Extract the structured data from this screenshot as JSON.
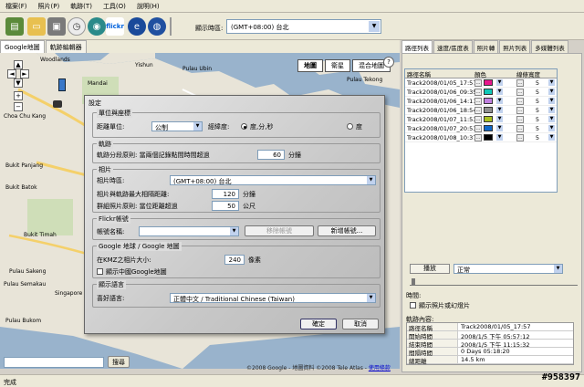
{
  "menu": [
    "檔案(F)",
    "照片(P)",
    "軌跡(T)",
    "工具(O)",
    "說明(H)"
  ],
  "toolbar": {
    "timezone_label": "顯示時區:",
    "timezone_value": "(GMT+08:00) 台北",
    "flickr_label": "flickr",
    "icons": [
      "open-icon",
      "folder-icon",
      "save-icon",
      "clock-icon",
      "globe-icon",
      "flickr-icon",
      "ie-icon",
      "google-earth-icon"
    ]
  },
  "map_tabs": [
    "Google地圖",
    "軌跡編輯器"
  ],
  "map": {
    "types": [
      "地圖",
      "衛星",
      "混合地圖"
    ],
    "copyright": "©2008 Google - 地圖資料 ©2008 Tele Atlas - ",
    "terms_link": "使用條款",
    "search_button": "搜尋",
    "places": [
      "Woodlands",
      "Mandai",
      "Yishun",
      "Pulau Ubin",
      "Choa Chu Kang",
      "Bukit Panjang",
      "Bukit Batok",
      "Bukit Timah",
      "Pulau Tekong",
      "Singapore",
      "Pulau Sakeng",
      "Pulau Semakau",
      "Pulau Bukom"
    ]
  },
  "dialog": {
    "title": "設定",
    "group_unit": "單位與座標",
    "distance_unit_label": "距離單位:",
    "distance_unit_value": "公制",
    "coord_label": "經緯度:",
    "coord_opt1": "度,分,秒",
    "coord_opt2": "度",
    "group_track": "軌跡",
    "track_split_label": "軌跡分段原則: 當兩個記錄點間時間超過",
    "track_split_value": "60",
    "track_split_unit": "分鐘",
    "group_photo": "相片",
    "photo_tz_label": "相片時區:",
    "photo_tz_value": "(GMT+08:00) 台北",
    "photo_time_label": "相片與軌跡最大相隔距離:",
    "photo_time_value": "120",
    "photo_time_unit": "分鐘",
    "photo_group_label": "群組照片原則: 當位距離超過",
    "photo_group_value": "50",
    "photo_group_unit": "公尺",
    "group_flickr": "Flickr帳號",
    "flickr_account_label": "帳號名稱:",
    "flickr_remove": "移除帳號",
    "flickr_add": "新增帳號...",
    "group_google": "Google 地球 / Google 地圖",
    "kmz_label": "在KMZ之相片大小:",
    "kmz_value": "240",
    "kmz_unit": "像素",
    "china_map_label": "顯示中國Google地圖",
    "group_lang": "顯示語言",
    "lang_label": "喜好語言:",
    "lang_value": "正體中文 / Traditional Chinese (Taiwan)",
    "ok": "確定",
    "cancel": "取消"
  },
  "right_tabs": [
    "路徑列表",
    "速度/區度表",
    "照片轉",
    "照片列表",
    "多媒體列表"
  ],
  "tracks": {
    "headers": [
      "路徑名稱",
      "顏色",
      "線條寬度"
    ],
    "rows": [
      {
        "name": "Track2008/01/05_17:57",
        "color": "#e8168c",
        "width": "5"
      },
      {
        "name": "Track2008/01/06_09:35",
        "color": "#10c8b8",
        "width": "5"
      },
      {
        "name": "Track2008/01/06_14:11",
        "color": "#c080e0",
        "width": "5"
      },
      {
        "name": "Track2008/01/06_18:54",
        "color": "#909090",
        "width": "5"
      },
      {
        "name": "Track2008/01/07_11:53",
        "color": "#a8c020",
        "width": "5"
      },
      {
        "name": "Track2008/01/07_20:53",
        "color": "#1068c8",
        "width": "5"
      },
      {
        "name": "Track2008/01/08_10:37",
        "color": "#000000",
        "width": "5"
      }
    ]
  },
  "playback": {
    "play": "播放",
    "speed": "正常",
    "time_label": "時間:",
    "show_photo_label": "顯示照片或幻燈片",
    "info_label": "軌跡內容:"
  },
  "info": [
    {
      "k": "路徑名稱",
      "v": "Track2008/01/05_17:57"
    },
    {
      "k": "開始時間",
      "v": "2008/1/5 下午 05:57:12"
    },
    {
      "k": "結束時間",
      "v": "2008/1/5 下午 11:15:32"
    },
    {
      "k": "間隔時間",
      "v": "0 Days 05:18:20"
    },
    {
      "k": "總距離",
      "v": "14.5 km"
    }
  ],
  "status": "完成",
  "watermark": "#958397"
}
